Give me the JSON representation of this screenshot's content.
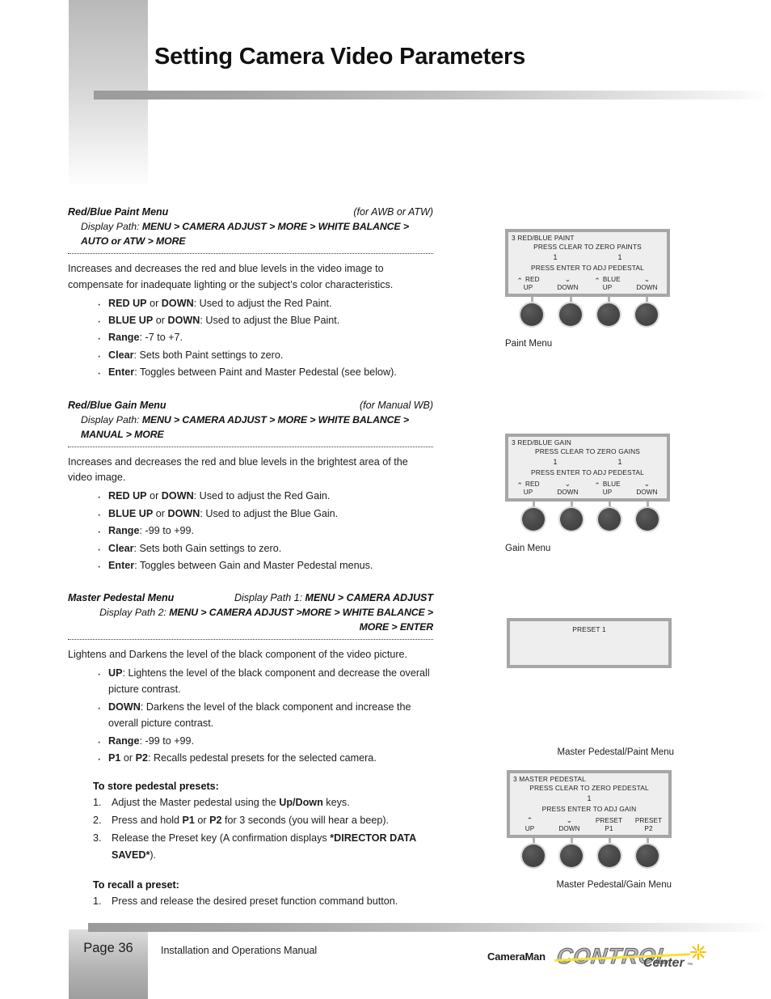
{
  "header": {
    "title": "Setting Camera Video Parameters"
  },
  "footer": {
    "page_label": "Page 36",
    "manual_label": "Installation and Operations Manual",
    "logo": {
      "brand": "CameraMan",
      "product": "CONTROL",
      "product_suffix": "Center",
      "trademark": "™",
      "stripe_color": "#f5e03a"
    }
  },
  "sections": [
    {
      "heading": "Red/Blue Paint Menu",
      "heading_right": "(for AWB or ATW)",
      "path_label": "Display Path:",
      "path_value": "MENU > CAMERA ADJUST > MORE > WHITE BALANCE > AUTO or ATW > MORE",
      "intro": "Increases and decreases the red and blue levels in the video image to compensate for inadequate lighting or the subject’s color characteristics.",
      "bullets": [
        {
          "term": "RED UP",
          "mid": " or ",
          "term2": "DOWN",
          "rest": ": Used to adjust the Red Paint."
        },
        {
          "term": "BLUE UP",
          "mid": " or ",
          "term2": "DOWN",
          "rest": ": Used to adjust the Blue Paint."
        },
        {
          "term": "Range",
          "mid": "",
          "term2": "",
          "rest": ": -7 to +7."
        },
        {
          "term": "Clear",
          "mid": "",
          "term2": "",
          "rest": ": Sets both Paint settings to zero."
        },
        {
          "term": "Enter",
          "mid": "",
          "term2": "",
          "rest": ": Toggles between Paint and Master Pedestal (see below)."
        }
      ]
    },
    {
      "heading": "Red/Blue Gain Menu",
      "heading_right": "(for Manual WB)",
      "path_label": "Display Path:",
      "path_value": "MENU > CAMERA ADJUST > MORE > WHITE BALANCE > MANUAL > MORE",
      "intro": "Increases and decreases the red and blue levels in the brightest area of the video image.",
      "bullets": [
        {
          "term": "RED UP",
          "mid": " or ",
          "term2": "DOWN",
          "rest": ": Used to adjust the Red Gain."
        },
        {
          "term": "BLUE UP",
          "mid": " or ",
          "term2": "DOWN",
          "rest": ": Used to adjust the Blue Gain."
        },
        {
          "term": "Range",
          "mid": "",
          "term2": "",
          "rest": ": -99 to +99."
        },
        {
          "term": "Clear",
          "mid": "",
          "term2": "",
          "rest": ": Sets both Gain settings to zero."
        },
        {
          "term": "Enter",
          "mid": "",
          "term2": "",
          "rest": ": Toggles between Gain and Master Pedestal menus."
        }
      ]
    },
    {
      "heading": "Master Pedestal Menu",
      "heading_right": "",
      "path1_label": "Display Path 1:",
      "path1_value": "MENU > CAMERA ADJUST",
      "path2_label": "Display Path 2:",
      "path2_value": "MENU > CAMERA ADJUST >MORE > WHITE BALANCE > MORE > ENTER",
      "intro": "Lightens and Darkens the level of the black component of the video picture.",
      "bullets": [
        {
          "term": "UP",
          "mid": "",
          "term2": "",
          "rest": ": Lightens the level of the black component and decrease the overall picture contrast."
        },
        {
          "term": "DOWN",
          "mid": "",
          "term2": "",
          "rest": ": Darkens the level of the black component and increase the overall picture contrast."
        },
        {
          "term": "Range",
          "mid": "",
          "term2": "",
          "rest": ": -99 to +99."
        },
        {
          "term": "P1",
          "mid": " or ",
          "term2": "P2",
          "rest": ": Recalls pedestal presets for the selected camera."
        }
      ]
    }
  ],
  "procedures": [
    {
      "title": "To store pedestal presets:",
      "steps": [
        {
          "pre": "Adjust the Master pedestal using the ",
          "b": "Up/Down",
          "post": " keys."
        },
        {
          "pre": "Press and hold ",
          "b": "P1",
          "mid": " or ",
          "b2": "P2",
          "post": " for 3 seconds (you will hear a beep)."
        },
        {
          "pre": "Release the Preset key (A confirmation displays ",
          "b": "*DIRECTOR DATA SAVED*",
          "post": ")."
        }
      ]
    },
    {
      "title": "To recall a preset:",
      "steps": [
        {
          "pre": "Press and release the desired preset function command button.",
          "b": "",
          "post": ""
        }
      ]
    }
  ],
  "panels": [
    {
      "id": "paint",
      "title": "3 RED/BLUE PAINT",
      "instruction1": "PRESS CLEAR TO ZERO PAINTS",
      "value_left": "1",
      "value_right": "1",
      "instruction2": "PRESS ENTER TO ADJ PEDESTAL",
      "keys": [
        {
          "group": "RED",
          "chev": "up",
          "label": "UP"
        },
        {
          "group": "",
          "chev": "down",
          "label": "DOWN"
        },
        {
          "group": "BLUE",
          "chev": "up",
          "label": "UP"
        },
        {
          "group": "",
          "chev": "down",
          "label": "DOWN"
        }
      ],
      "caption": "Paint Menu",
      "caption_align": "left"
    },
    {
      "id": "gain",
      "title": "3 RED/BLUE GAIN",
      "instruction1": "PRESS CLEAR TO ZERO GAINS",
      "value_left": "1",
      "value_right": "1",
      "instruction2": "PRESS ENTER TO ADJ PEDESTAL",
      "keys": [
        {
          "group": "RED",
          "chev": "up",
          "label": "UP"
        },
        {
          "group": "",
          "chev": "down",
          "label": "DOWN"
        },
        {
          "group": "BLUE",
          "chev": "up",
          "label": "UP"
        },
        {
          "group": "",
          "chev": "down",
          "label": "DOWN"
        }
      ],
      "caption": "Gain Menu",
      "caption_align": "left"
    },
    {
      "id": "preset",
      "title": "",
      "instruction1": "PRESET 1",
      "value_left": "",
      "value_right": "",
      "instruction2": "",
      "keys": [],
      "caption": "Master Pedestal/Paint Menu",
      "caption_align": "right"
    },
    {
      "id": "master-pedestal",
      "title": "3 MASTER PEDESTAL",
      "instruction1": "PRESS CLEAR TO ZERO PEDESTAL",
      "value_left": "1",
      "value_right": "",
      "instruction2": "PRESS ENTER TO ADJ GAIN",
      "keys": [
        {
          "group": "",
          "chev": "up",
          "label": "UP"
        },
        {
          "group": "",
          "chev": "down",
          "label": "DOWN"
        },
        {
          "group": "",
          "chev": "",
          "label": "PRESET",
          "label2": "P1"
        },
        {
          "group": "",
          "chev": "",
          "label": "PRESET",
          "label2": "P2"
        }
      ],
      "caption": "Master Pedestal/Gain Menu",
      "caption_align": "right"
    }
  ]
}
